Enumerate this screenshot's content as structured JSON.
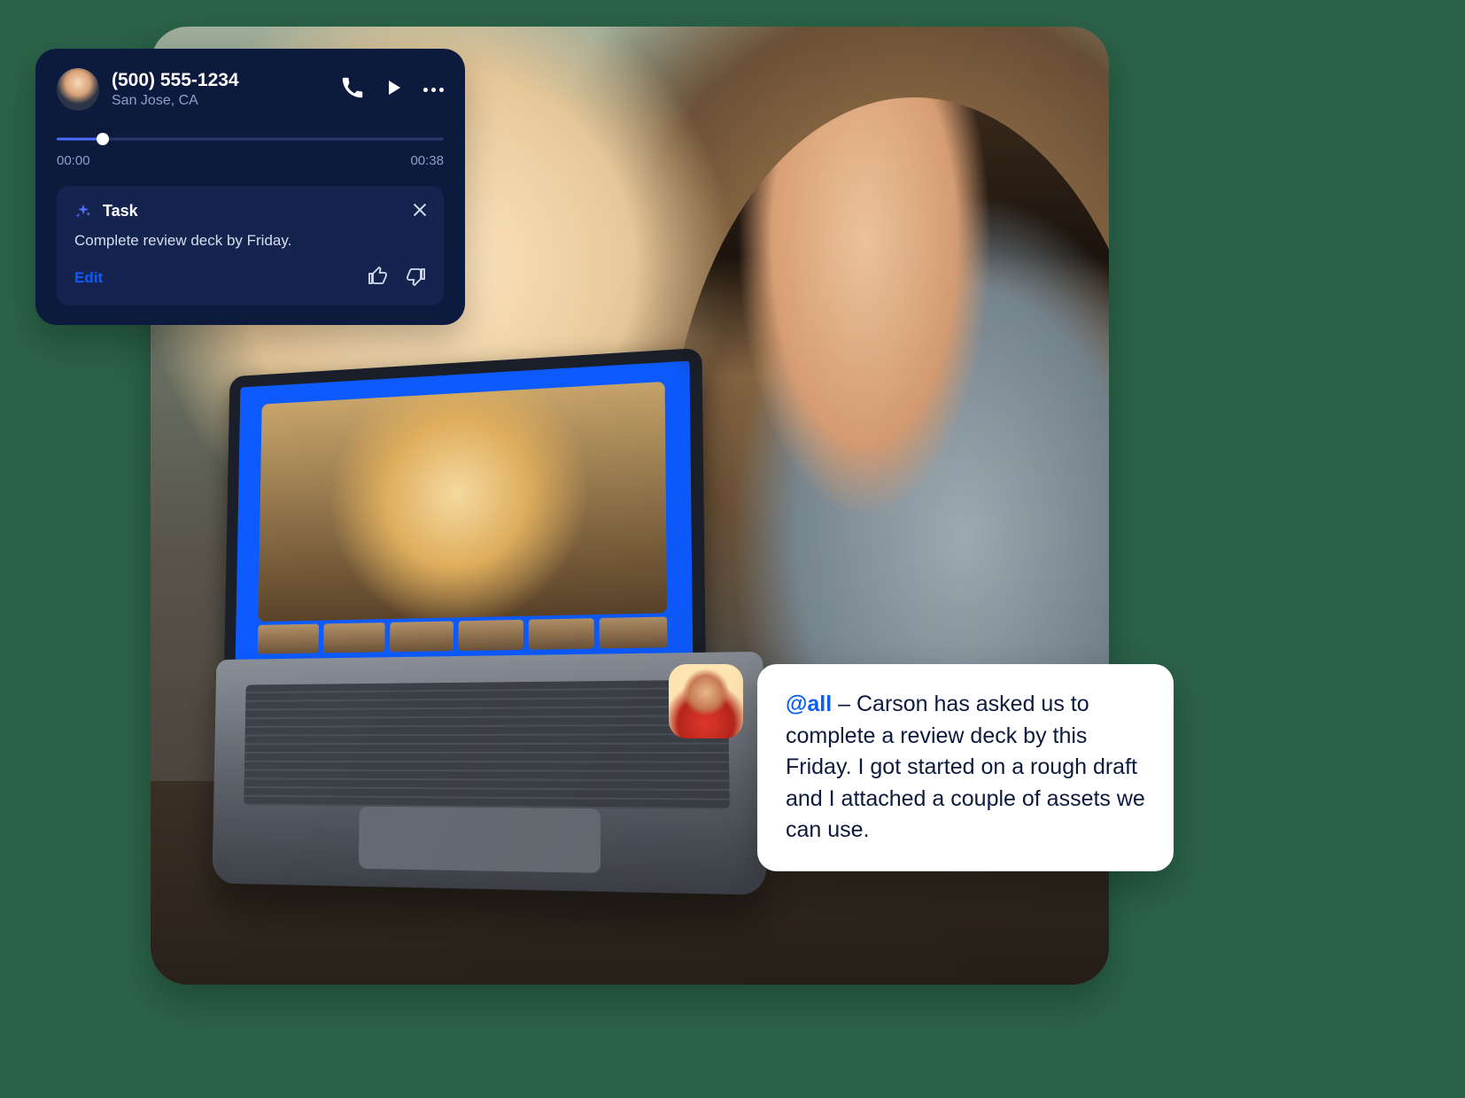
{
  "voicemail_card": {
    "phone_number": "(500) 555-1234",
    "location": "San Jose, CA",
    "time_elapsed": "00:00",
    "time_total": "00:38",
    "progress_percent": 12,
    "task": {
      "label": "Task",
      "body": "Complete review deck by Friday.",
      "edit_label": "Edit"
    },
    "icons": {
      "call": "phone-icon",
      "play": "play-icon",
      "more": "more-icon",
      "sparkle": "sparkle-icon",
      "close": "close-icon",
      "thumbs_up": "thumbs-up-icon",
      "thumbs_down": "thumbs-down-icon"
    }
  },
  "chat_message": {
    "mention": "@all",
    "separator": " – ",
    "body": "Carson has asked us to complete a review deck by this Friday. I got started on a rough draft and I attached a couple of assets we can use."
  },
  "colors": {
    "navy": "#0b1a3d",
    "accent_blue": "#0b5cff",
    "mid_blue": "#4d6dff"
  }
}
